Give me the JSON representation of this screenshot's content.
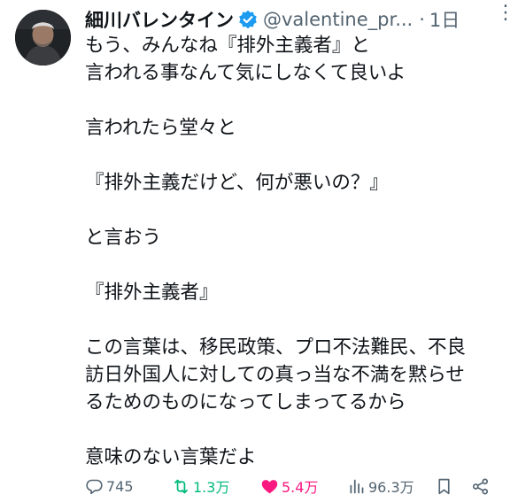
{
  "author": {
    "display_name": "細川バレンタイン",
    "handle": "@valentine_pr...",
    "separator": "·",
    "time_ago": "1日",
    "avatar": "profile-photo",
    "verified_color": "#1d9bf0"
  },
  "menu": {
    "icon": "more-dots-icon",
    "glyph": "⋮"
  },
  "tweet": {
    "lines": [
      "もう、みんなね『排外主義者』と",
      "言われる事なんて気にしなくて良いよ",
      "",
      "言われたら堂々と",
      "",
      "『排外主義だけど、何が悪いの？』",
      "",
      "と言おう",
      "",
      "『排外主義者』",
      "",
      "この言葉は、移民政策、プロ不法難民、不良",
      "訪日外国人に対しての真っ当な不満を黙らせ",
      "るためのものになってしまってるから",
      "",
      "意味のない言葉だよ"
    ]
  },
  "actions": {
    "replies": "745",
    "reposts": "1.3万",
    "likes": "5.4万",
    "views": "96.3万",
    "colors": {
      "default": "#536471",
      "repost": "#00ba7c",
      "like": "#f91880"
    }
  }
}
